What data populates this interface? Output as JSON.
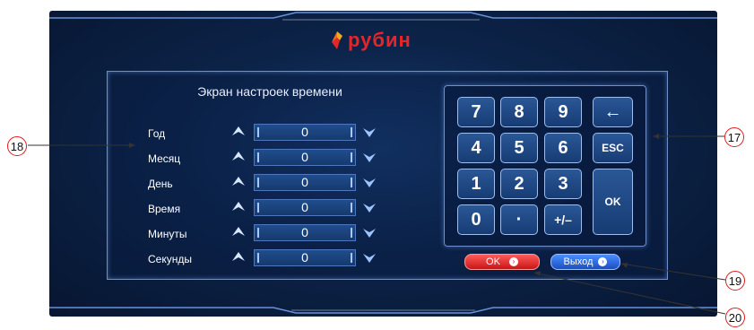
{
  "brand": {
    "name": "рубин",
    "accent": "#e8242b"
  },
  "panel": {
    "title": "Экран настроек времени",
    "rows": [
      {
        "label": "Год",
        "value": "0"
      },
      {
        "label": "Месяц",
        "value": "0"
      },
      {
        "label": "День",
        "value": "0"
      },
      {
        "label": "Время",
        "value": "0"
      },
      {
        "label": "Минуты",
        "value": "0"
      },
      {
        "label": "Секунды",
        "value": "0"
      }
    ]
  },
  "keypad": {
    "keys": [
      "7",
      "8",
      "9",
      "←",
      "4",
      "5",
      "6",
      "ESC",
      "1",
      "2",
      "3",
      "OK",
      "0",
      "·",
      "+/–"
    ]
  },
  "buttons": {
    "ok": "OK",
    "exit": "Выход"
  },
  "callouts": {
    "c17": "17",
    "c18": "18",
    "c19": "19",
    "c20": "20"
  },
  "colors": {
    "screen_bg": "#0c2348",
    "ok_button": "#e02020",
    "exit_button": "#2b64d8",
    "callout_border": "#e01c1c"
  }
}
